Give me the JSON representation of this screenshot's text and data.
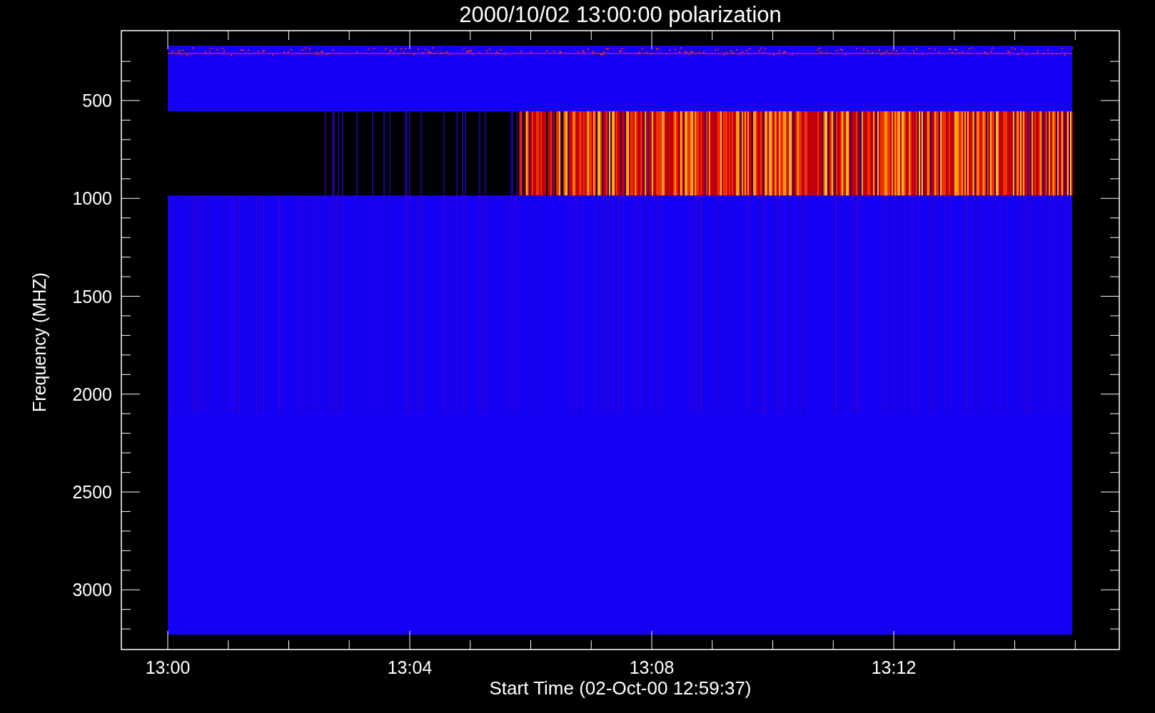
{
  "title": "2000/10/02 13:00:00 polarization",
  "y_axis": {
    "label": "Frequency (MHZ)",
    "ticks": [
      "500",
      "1000",
      "1500",
      "2000",
      "2500",
      "3000"
    ]
  },
  "x_axis": {
    "label": "Start Time (02-Oct-00 12:59:37)",
    "ticks": [
      "13:00",
      "13:04",
      "13:08",
      "13:12"
    ]
  }
}
